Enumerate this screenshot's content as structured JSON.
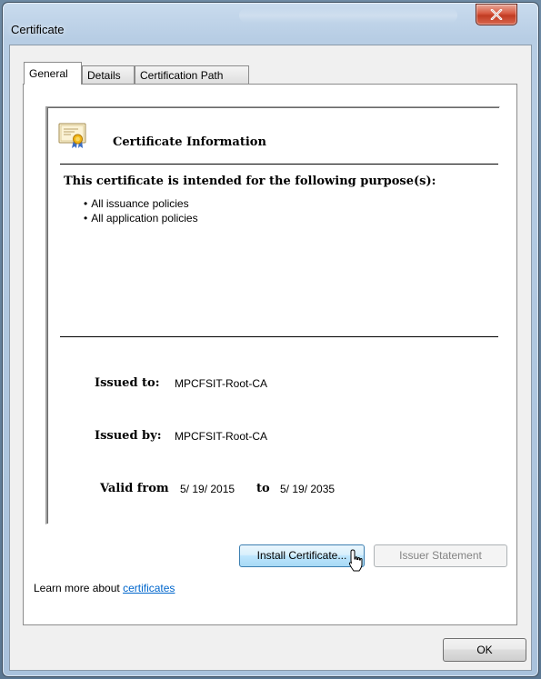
{
  "window": {
    "title": "Certificate",
    "close_glyph": "x"
  },
  "tabs": [
    {
      "label": "General",
      "active": true
    },
    {
      "label": "Details",
      "active": false
    },
    {
      "label": "Certification Path",
      "active": false
    }
  ],
  "info": {
    "icon": "certificate-icon",
    "title": "Certificate Information",
    "purpose_heading": "This certificate is intended for the following purpose(s):",
    "purposes": [
      "All issuance policies",
      "All application policies"
    ],
    "issued_to_label": "Issued to:",
    "issued_to": "MPCFSIT-Root-CA",
    "issued_by_label": "Issued by:",
    "issued_by": "MPCFSIT-Root-CA",
    "valid_from_label": "Valid from",
    "valid_from": "5/ 19/ 2015",
    "valid_to_label": "to",
    "valid_to": "5/ 19/ 2035"
  },
  "buttons": {
    "install": "Install Certificate...",
    "issuer_statement": "Issuer Statement",
    "ok": "OK"
  },
  "learn_more": {
    "prefix": "Learn more about ",
    "link": "certificates"
  },
  "colors": {
    "link": "#0066cc",
    "close_button": "#c13b22",
    "hover_button": "#bee6fd"
  }
}
